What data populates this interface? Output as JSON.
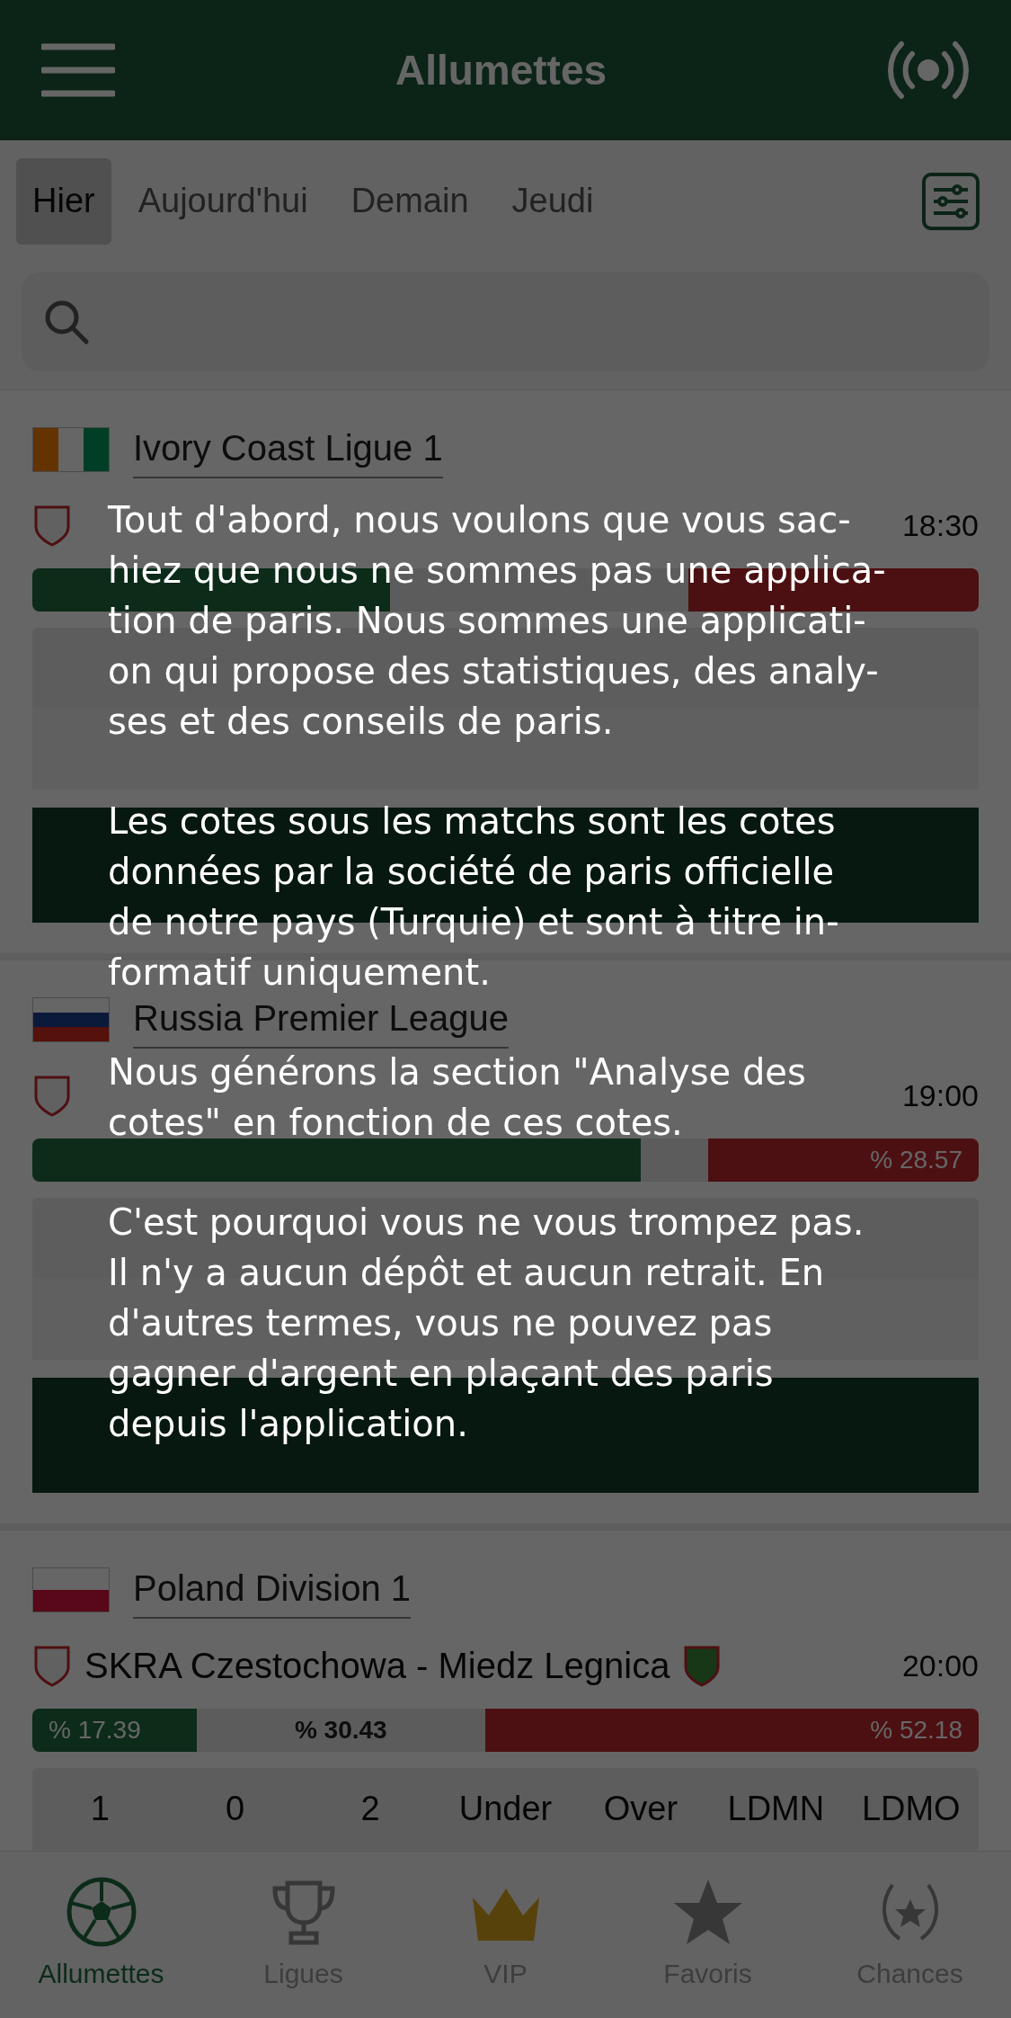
{
  "header": {
    "title": "Allumettes"
  },
  "tabs": [
    {
      "label": "Hier",
      "selected": true
    },
    {
      "label": "Aujourd'hui",
      "selected": false
    },
    {
      "label": "Demain",
      "selected": false
    },
    {
      "label": "Jeudi",
      "selected": false
    }
  ],
  "leagues": [
    {
      "name": "Ivory Coast Ligue 1",
      "matches": [
        {
          "time": "18:30",
          "bar": {
            "home": {
              "level": 0.3784
            },
            "away": {
              "level": 0.3063
            }
          }
        }
      ]
    },
    {
      "name": "Russia Premier League",
      "matches": [
        {
          "time": "19:00",
          "bar": {
            "home": {
              "level": 0.6429
            },
            "away": {
              "level": 0.2857,
              "text": "% 28.57"
            }
          }
        }
      ]
    },
    {
      "name": "Poland Division 1",
      "matches": [
        {
          "teams": "SKRA Czestochowa - Miedz Legnica",
          "time": "20:00",
          "bar": {
            "home": {
              "level": 0.1739,
              "text": "% 17.39"
            },
            "draw": {
              "text": "% 30.43"
            },
            "away": {
              "level": 0.5218,
              "text": "% 52.18"
            }
          },
          "odds_headers": [
            "1",
            "0",
            "2",
            "Under",
            "Over",
            "LDMN",
            "LDMO"
          ]
        }
      ]
    }
  ],
  "nav": [
    {
      "label": "Allumettes",
      "kind": "ball",
      "selected": true
    },
    {
      "label": "Ligues",
      "kind": "trophy",
      "selected": false
    },
    {
      "label": "VIP",
      "kind": "crown",
      "selected": false
    },
    {
      "label": "Favoris",
      "kind": "star",
      "selected": false
    },
    {
      "label": "Chances",
      "kind": "laurel",
      "selected": false
    }
  ],
  "notice": {
    "paragraphs": [
      [
        "Tout d'abord, nous voulons que vous sac-",
        "hiez que nous ne sommes pas une applica-",
        "tion de paris. Nous sommes une applicati-",
        "on qui propose des statistiques, des analy-",
        "ses et des conseils de paris."
      ],
      [
        "Les cotes sous les matchs sont les cotes",
        "données par la société de paris officielle",
        "de notre pays (Turquie) et sont à titre in-",
        "formatif uniquement."
      ],
      [
        "Nous générons la section \"Analyse des",
        "cotes\" en fonction de ces cotes."
      ],
      [
        "C'est pourquoi vous ne vous trompez pas.",
        "Il n'y a aucun dépôt et aucun retrait. En",
        "d'autres termes, vous ne pouvez pas",
        "gagner d'argent en plaçant des paris",
        "depuis l'application."
      ]
    ]
  }
}
